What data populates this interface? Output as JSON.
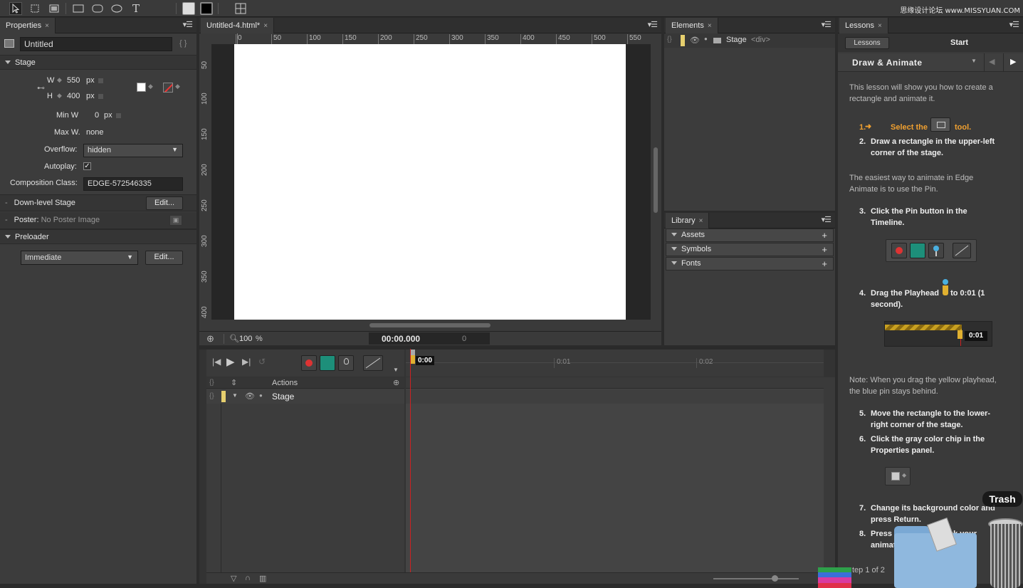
{
  "toolbar": {
    "watermark": "思缘设计论坛 www.MISSYUAN.COM",
    "tools": [
      "selection-tool",
      "transform-tool",
      "clipping-tool",
      "rectangle-tool",
      "rounded-rectangle-tool",
      "ellipse-tool",
      "text-tool"
    ]
  },
  "properties": {
    "tab": "Properties",
    "title": "Untitled",
    "stage_section": "Stage",
    "w_label": "W",
    "w_value": "550",
    "h_label": "H",
    "h_value": "400",
    "unit": "px",
    "minw_label": "Min W",
    "minw_value": "0",
    "maxw_label": "Max W.",
    "maxw_value": "none",
    "overflow_label": "Overflow:",
    "overflow_value": "hidden",
    "autoplay_label": "Autoplay:",
    "autoplay_check": "✓",
    "comp_label": "Composition Class:",
    "comp_value": "EDGE-572546335",
    "downlevel_label": "Down-level Stage",
    "edit_label": "Edit...",
    "poster_label": "Poster:",
    "poster_value": "No Poster Image",
    "preloader_section": "Preloader",
    "preloader_value": "Immediate",
    "bracket_icon": "{ }"
  },
  "document": {
    "tab": "Untitled-4.html*",
    "ruler_top": [
      "0",
      "50",
      "100",
      "150",
      "200",
      "250",
      "300",
      "350",
      "400",
      "450",
      "500",
      "550"
    ],
    "ruler_left": [
      "50",
      "100",
      "150",
      "200",
      "250",
      "300",
      "350",
      "400"
    ],
    "zoom": "100",
    "zoom_unit": "%",
    "time": "00:00.000",
    "frame": "0"
  },
  "elements": {
    "tab": "Elements",
    "stage_label": "Stage",
    "stage_tag": "<div>"
  },
  "library": {
    "tab": "Library",
    "sections": [
      "Assets",
      "Symbols",
      "Fonts"
    ]
  },
  "lessons": {
    "tab": "Lessons",
    "back": "Lessons",
    "start": "Start",
    "title": "Draw & Animate",
    "intro": "This lesson will show you how to create a rectangle and animate it.",
    "step1_num": "1.",
    "step1_a": "Select the",
    "step1_b": "tool.",
    "step2_num": "2.",
    "step2": "Draw a rectangle in the upper-left corner of the stage.",
    "para2": "The easiest way to animate in Edge Animate is to use the Pin.",
    "step3_num": "3.",
    "step3": "Click the Pin button in the Timeline.",
    "step4_num": "4.",
    "step4_a": "Drag the Playhead",
    "step4_b": "to 0:01 (1 second).",
    "mini_time": "0:01",
    "note": "Note: When you drag the yellow playhead, the blue pin stays behind.",
    "step5_num": "5.",
    "step5": "Move the rectangle to the lower-right corner of the stage.",
    "step6_num": "6.",
    "step6": "Click the gray color chip in the Properties panel.",
    "step7_num": "7.",
    "step7": "Change its background color and press Return.",
    "step8_num": "8.",
    "step8": "Press Spa",
    "step8_b": "ck your",
    "step8_c": "animat",
    "footer": "tep 1 of 2"
  },
  "timeline": {
    "playhead_time": "0:00",
    "marks": [
      "0:01",
      "0:02"
    ],
    "actions_label": "Actions",
    "stage_label": "Stage"
  },
  "dock": {
    "trash_label": "Trash"
  }
}
